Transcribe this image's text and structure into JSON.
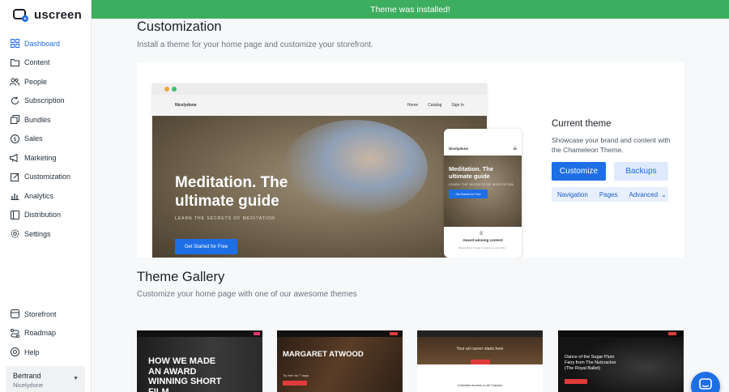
{
  "brand": {
    "name": "uscreen"
  },
  "banner": {
    "text": "Theme was installed!"
  },
  "sidebar": {
    "items": [
      {
        "label": "Dashboard",
        "icon": "dashboard-icon"
      },
      {
        "label": "Content",
        "icon": "folder-icon"
      },
      {
        "label": "People",
        "icon": "people-icon"
      },
      {
        "label": "Subscription",
        "icon": "refresh-icon"
      },
      {
        "label": "Bundles",
        "icon": "layers-icon"
      },
      {
        "label": "Sales",
        "icon": "dollar-icon"
      },
      {
        "label": "Marketing",
        "icon": "megaphone-icon"
      },
      {
        "label": "Customization",
        "icon": "edit-icon"
      },
      {
        "label": "Analytics",
        "icon": "chart-icon"
      },
      {
        "label": "Distribution",
        "icon": "devices-icon"
      },
      {
        "label": "Settings",
        "icon": "gear-icon"
      }
    ],
    "bottom": [
      {
        "label": "Storefront",
        "icon": "store-icon"
      },
      {
        "label": "Roadmap",
        "icon": "roadmap-icon"
      },
      {
        "label": "Help",
        "icon": "help-icon"
      }
    ],
    "user": {
      "name": "Bertrand",
      "site": "Nicelydone"
    }
  },
  "main": {
    "title": "Customization",
    "subtitle": "Install a theme for your home page and customize your storefront.",
    "preview": {
      "browser_brand": "Nicelydone",
      "browser_links": [
        "Home",
        "Catalog",
        "Sign In"
      ],
      "hero_title": "Meditation. The ultimate guide",
      "hero_tagline": "LEARN THE SECRETS OF MEDITATION",
      "hero_button": "Get Started for Free",
      "phone_brand": "Nicelydone",
      "phone_title": "Meditation. The ultimate guide",
      "phone_tagline": "LEARN THE SECRETS OF MEDITATION",
      "phone_button": "Get Started for Free",
      "phone_award": "Award winning content",
      "phone_award_sub": "People like a \"proven\" product so your offer..."
    },
    "current_theme": {
      "title": "Current theme",
      "description": "Showcase your brand and content with the Chameleon Theme.",
      "customize_label": "Customize",
      "backups_label": "Backups",
      "subnav": [
        "Navigation",
        "Pages",
        "Advanced"
      ]
    },
    "gallery": {
      "title": "Theme Gallery",
      "subtitle": "Customize your home page with one of our awesome themes",
      "themes": [
        {
          "headline": "HOW WE MADE AN AWARD WINNING SHORT FILM",
          "bg": "#2a2a2a",
          "accent": "#e8336b"
        },
        {
          "headline": "MARGARET ATWOOD",
          "sub": "Try free for 7 days",
          "bg": "#3a2a1f",
          "accent": "#e13b3b"
        },
        {
          "headline": "Your art career starts here",
          "sub": "Unlimited Access to All Classes",
          "bg": "#4a3828",
          "accent": "#e13b3b"
        },
        {
          "headline": "Dance of the Sugar Plum Fairy from The Nutcracker (The Royal Ballet)",
          "bg": "#141414",
          "accent": "#e13b3b"
        }
      ]
    }
  },
  "colors": {
    "accent": "#1e6ee6",
    "success": "#3dae5f"
  }
}
